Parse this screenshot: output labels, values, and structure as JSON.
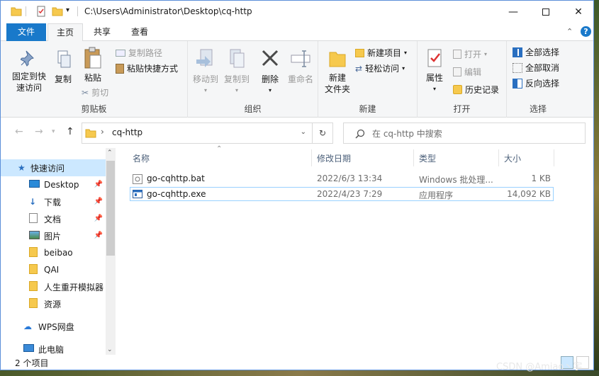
{
  "window": {
    "path": "C:\\Users\\Administrator\\Desktop\\cq-http"
  },
  "tabs": {
    "file": "文件",
    "home": "主页",
    "share": "共享",
    "view": "查看"
  },
  "ribbon": {
    "clipboard": {
      "label": "剪贴板",
      "pin": "固定到快\n速访问",
      "copy": "复制",
      "paste": "粘贴",
      "copy_path": "复制路径",
      "paste_shortcut": "粘贴快捷方式",
      "cut": "剪切"
    },
    "organize": {
      "label": "组织",
      "move_to": "移动到",
      "copy_to": "复制到",
      "delete": "删除",
      "rename": "重命名"
    },
    "new": {
      "label": "新建",
      "new_folder": "新建\n文件夹",
      "new_item": "新建项目",
      "easy_access": "轻松访问"
    },
    "open": {
      "label": "打开",
      "properties": "属性",
      "open": "打开",
      "edit": "编辑",
      "history": "历史记录"
    },
    "select": {
      "label": "选择",
      "select_all": "全部选择",
      "select_none": "全部取消",
      "invert": "反向选择"
    }
  },
  "address": {
    "folder": "cq-http",
    "search_placeholder": "在 cq-http 中搜索"
  },
  "nav": {
    "quick_access": "快速访问",
    "items": [
      "Desktop",
      "下载",
      "文档",
      "图片",
      "beibao",
      "QAI",
      "人生重开模拟器",
      "资源"
    ],
    "wps": "WPS网盘",
    "this_pc": "此电脑"
  },
  "columns": {
    "name": "名称",
    "date": "修改日期",
    "type": "类型",
    "size": "大小"
  },
  "files": [
    {
      "name": "go-cqhttp.bat",
      "date": "2022/6/3 13:34",
      "type": "Windows 批处理...",
      "size": "1 KB"
    },
    {
      "name": "go-cqhttp.exe",
      "date": "2022/4/23 7:29",
      "type": "应用程序",
      "size": "14,092 KB"
    }
  ],
  "status": {
    "count": "2 个项目"
  },
  "watermark": "CSDN @Amiao丶宇"
}
